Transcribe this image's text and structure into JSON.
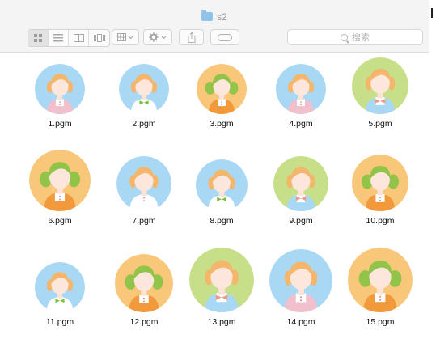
{
  "window": {
    "title": "s2",
    "search_placeholder": "搜索",
    "view_modes": [
      "icon-view",
      "list-view",
      "column-view",
      "coverflow-view"
    ],
    "selected_view": "icon-view"
  },
  "files": [
    {
      "label": "1.pgm",
      "bg": "#a9d8f5",
      "hair": "#f4b66b",
      "shirt": "#f2c0cc",
      "accent": "#ffffff"
    },
    {
      "label": "2.pgm",
      "bg": "#a9d8f5",
      "hair": "#f4b66b",
      "shirt": "#ffffff",
      "accent": "#7bbf3f"
    },
    {
      "label": "3.pgm",
      "bg": "#f9c77a",
      "hair": "#93c44a",
      "shirt": "#f29a3b",
      "accent": "#ffffff"
    },
    {
      "label": "4.pgm",
      "bg": "#a9d8f5",
      "hair": "#f4b66b",
      "shirt": "#f2c0cc",
      "accent": "#ffffff"
    },
    {
      "label": "5.pgm",
      "bg": "#c6df88",
      "hair": "#f4b66b",
      "shirt": "#a9d8f5",
      "accent": "#f29a88"
    },
    {
      "label": "6.pgm",
      "bg": "#f9c77a",
      "hair": "#93c44a",
      "shirt": "#f29a3b",
      "accent": "#ffffff"
    },
    {
      "label": "7.pgm",
      "bg": "#a9d8f5",
      "hair": "#f4b66b",
      "shirt": "#ffffff",
      "accent": "#ffffff"
    },
    {
      "label": "8.pgm",
      "bg": "#a9d8f5",
      "hair": "#f4b66b",
      "shirt": "#ffffff",
      "accent": "#7bbf3f"
    },
    {
      "label": "9.pgm",
      "bg": "#c6df88",
      "hair": "#f4b66b",
      "shirt": "#a9d8f5",
      "accent": "#f29a88"
    },
    {
      "label": "10.pgm",
      "bg": "#f9c77a",
      "hair": "#93c44a",
      "shirt": "#f29a3b",
      "accent": "#ffffff"
    },
    {
      "label": "11.pgm",
      "bg": "#a9d8f5",
      "hair": "#f4b66b",
      "shirt": "#ffffff",
      "accent": "#7bbf3f"
    },
    {
      "label": "12.pgm",
      "bg": "#f9c77a",
      "hair": "#93c44a",
      "shirt": "#f29a3b",
      "accent": "#ffffff"
    },
    {
      "label": "13.pgm",
      "bg": "#c6df88",
      "hair": "#f4b66b",
      "shirt": "#a9d8f5",
      "accent": "#f29a88"
    },
    {
      "label": "14.pgm",
      "bg": "#a9d8f5",
      "hair": "#f4b66b",
      "shirt": "#f2c0cc",
      "accent": "#ffffff"
    },
    {
      "label": "15.pgm",
      "bg": "#f9c77a",
      "hair": "#93c44a",
      "shirt": "#f29a3b",
      "accent": "#ffffff"
    }
  ]
}
